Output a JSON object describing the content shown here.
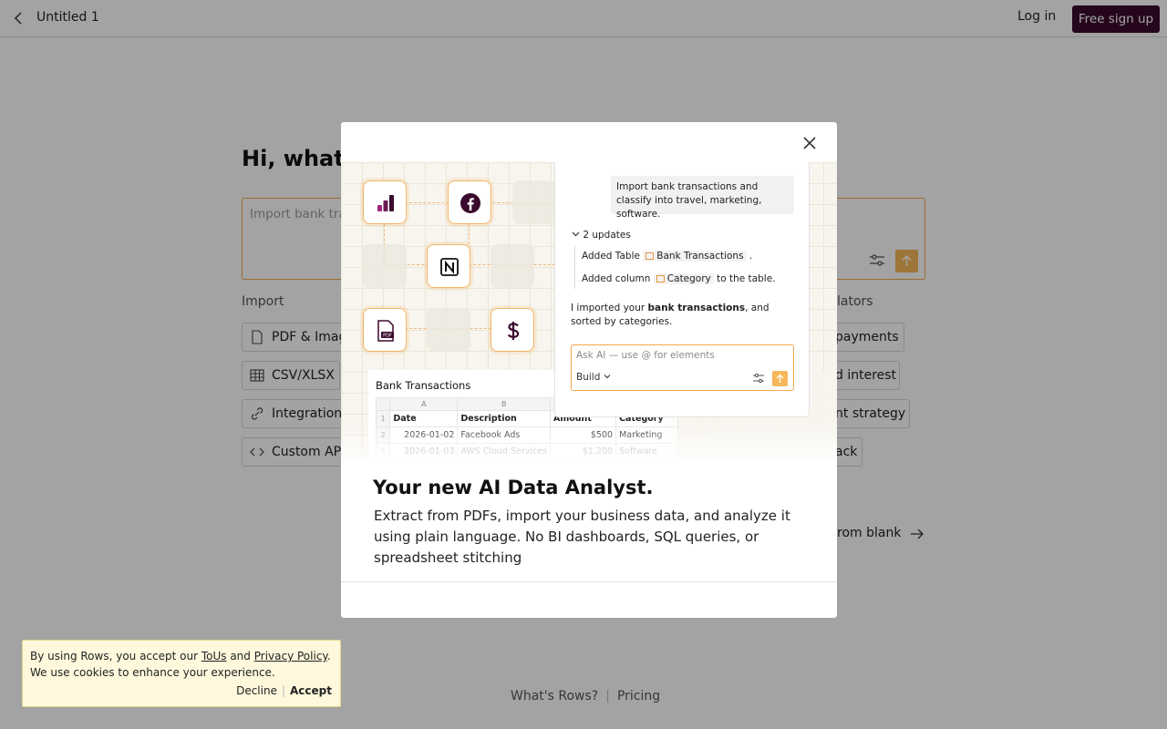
{
  "topbar": {
    "title": "Untitled 1",
    "login": "Log in",
    "signup": "Free sign up"
  },
  "main": {
    "greeting": "Hi, what c",
    "prompt_placeholder": "Import bank tra",
    "import_label": "Import",
    "calculators_label": "lators",
    "import_items": [
      "PDF & Imag",
      "CSV/XLSX",
      "Integration",
      "Custom API"
    ],
    "right_items": [
      "payments",
      "d interest",
      "nt strategy",
      "ack"
    ],
    "start_blank": "rom blank"
  },
  "footer": {
    "whats_rows": "What's Rows?",
    "sep": "|",
    "pricing": "Pricing"
  },
  "cookie": {
    "text_before": "By using Rows, you accept our ",
    "tous": "ToUs",
    "and": " and ",
    "privacy": "Privacy Policy",
    "period": ".",
    "line2": "We use cookies to enhance your experience.",
    "decline": "Decline",
    "sep": "|",
    "accept": "Accept"
  },
  "modal": {
    "title": "Your new AI Data Analyst.",
    "description": "Extract from PDFs, import your business data, and analyze it using plain language. No BI dashboards, SQL queries, or spreadsheet stitching",
    "chat": {
      "user_message": "Import bank transactions and classify into travel, marketing, software.",
      "updates_label": "2 updates",
      "update1_prefix": "Added Table",
      "update1_tag": "Bank Transactions",
      "update1_suffix": ".",
      "update2_prefix": "Added column",
      "update2_tag": "Category",
      "update2_suffix": "to the table.",
      "summary_a": "I imported your ",
      "summary_b": "bank transactions",
      "summary_c": ", and sorted by categories.",
      "ask_placeholder": "Ask AI — use @ for elements",
      "build_label": "Build"
    },
    "sheet": {
      "title": "Bank Transactions",
      "col_letters": [
        "A",
        "B",
        ""
      ],
      "headers": [
        "Date",
        "Description",
        "Amount",
        "Category"
      ],
      "rows": [
        [
          "2026-01-02",
          "Facebook Ads",
          "$500",
          "Marketing"
        ],
        [
          "2026-01-03",
          "AWS Cloud Services",
          "$1,200",
          "Software"
        ]
      ],
      "row_numbers": [
        "1",
        "2",
        "3"
      ],
      "pdf_badge": "PDF"
    }
  },
  "colors": {
    "accent": "#f2a64a",
    "brand": "#3b0a2e",
    "cookie_bg": "#fff8dd"
  }
}
